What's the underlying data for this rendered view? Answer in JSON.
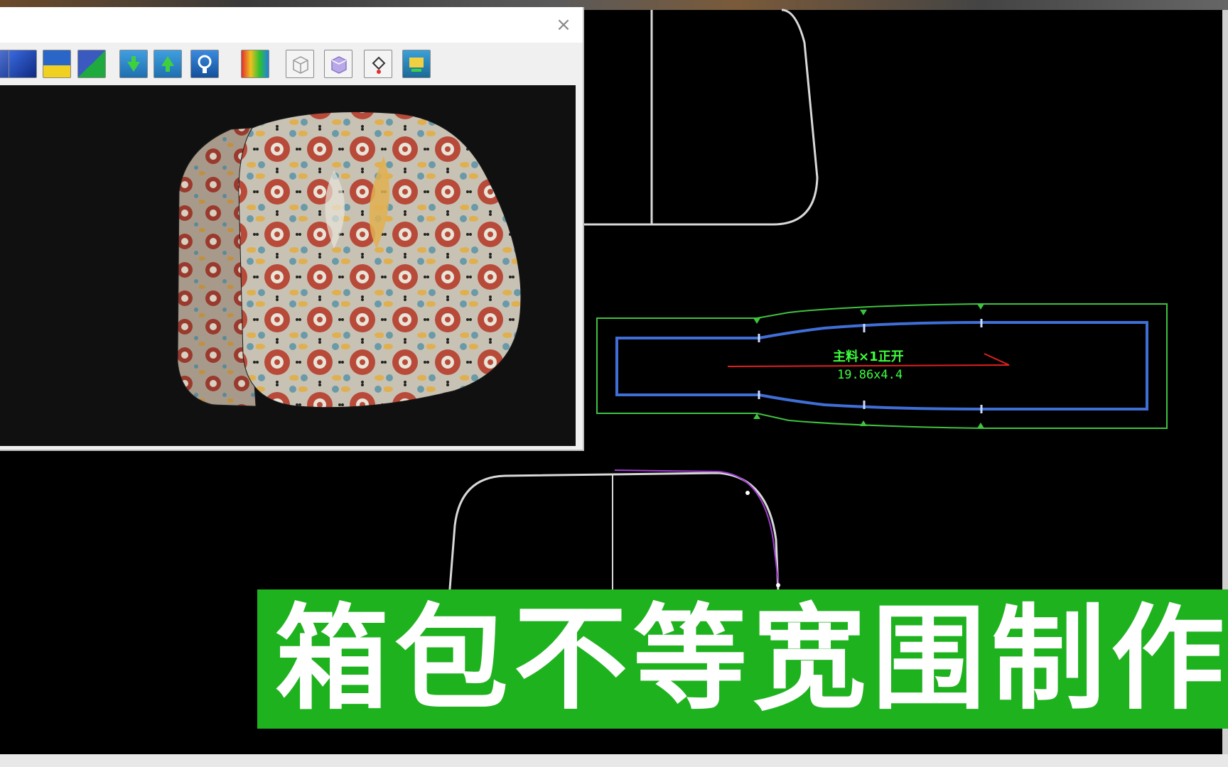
{
  "preview_window": {
    "close_glyph": "×",
    "toolbar": [
      {
        "name": "view-mode-icon-1",
        "color": "#2c4fa8"
      },
      {
        "name": "view-mode-icon-2",
        "color": "#1f4fb8"
      },
      {
        "name": "fill-icon",
        "color": "#2a66c8"
      },
      {
        "name": "shade-icon",
        "color": "#3a5ac0"
      },
      {
        "name": "move-down-icon",
        "color": "#2f8fd0"
      },
      {
        "name": "move-up-icon",
        "color": "#2f8fd0"
      },
      {
        "name": "rotate-icon",
        "color": "#1f6fc0"
      },
      {
        "name": "texture-icon",
        "color": "#e0a020"
      },
      {
        "name": "box-wireframe-icon",
        "color": "#e8e8e8"
      },
      {
        "name": "box-solid-icon",
        "color": "#b8a8e8"
      },
      {
        "name": "paint-bucket-icon",
        "color": "#f0f0f0"
      },
      {
        "name": "render-icon",
        "color": "#2a8ab8"
      }
    ]
  },
  "cad": {
    "label_main": "主料×1正开",
    "label_size": "19.86x4.4",
    "colors": {
      "outline": "#d8d8d8",
      "seam_allowance": "#3fc23f",
      "net_line": "#3f6fd6",
      "grain_line": "#e02020",
      "highlight": "#a03cd0",
      "label": "#3cff3c"
    }
  },
  "banner": {
    "title": "箱包不等宽围制作",
    "color": "#1fb21f"
  }
}
